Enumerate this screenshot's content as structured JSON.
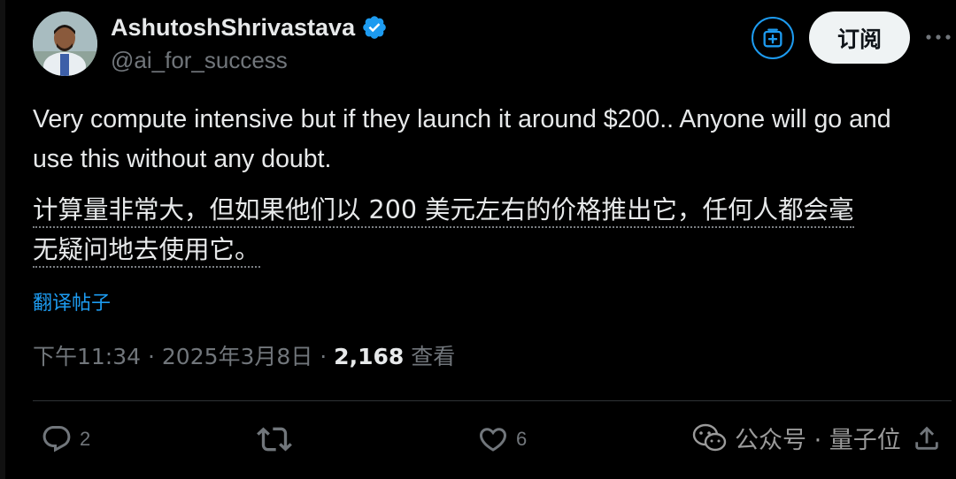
{
  "author": {
    "display_name": "AshutoshShrivastava",
    "handle": "@ai_for_success",
    "verified": true
  },
  "header": {
    "subscribe_label": "订阅",
    "more_label": "···"
  },
  "post": {
    "text_en": "Very compute intensive but if they launch it around $200.. Anyone will go and use this without any doubt.",
    "text_zh_line1": "计算量非常大，但如果他们以 200 美元左右的价格推出它，任何人都会毫",
    "text_zh_line2": "无疑问地去使用它。",
    "translate_label": "翻译帖子"
  },
  "meta": {
    "time": "下午11:34",
    "separator": " · ",
    "date": "2025年3月8日",
    "views_count": "2,168",
    "views_label": " 查看"
  },
  "actions": {
    "reply_count": "2",
    "like_count": "6"
  },
  "watermark": {
    "text": "公众号 · 量子位"
  },
  "colors": {
    "background": "#000000",
    "text_primary": "#e7e9ea",
    "text_secondary": "#71767b",
    "accent": "#1d9bf0",
    "verified": "#1d9bf0"
  }
}
